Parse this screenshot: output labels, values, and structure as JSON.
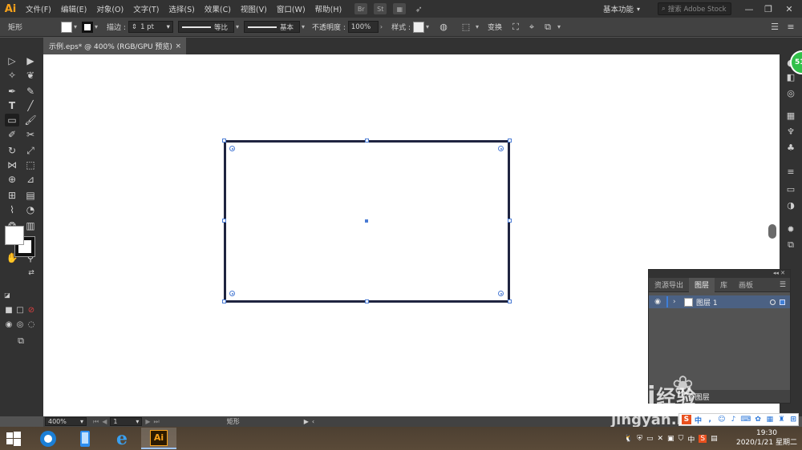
{
  "app": {
    "logo": "Ai",
    "menus": [
      "文件(F)",
      "编辑(E)",
      "对象(O)",
      "文字(T)",
      "选择(S)",
      "效果(C)",
      "视图(V)",
      "窗口(W)",
      "帮助(H)"
    ],
    "bridge_icon": "Br",
    "stock_icon": "St",
    "workspace": "基本功能",
    "search_placeholder": "搜索 Adobe Stock"
  },
  "control_bar": {
    "object_type": "矩形",
    "stroke_label": "描边 :",
    "stroke_weight": "1 pt",
    "profile_label": "等比",
    "brush_label": "基本",
    "opacity_label": "不透明度 :",
    "opacity_value": "100%",
    "style_label": "样式 :",
    "transform_label": "变换"
  },
  "document": {
    "tab_title": "示例.eps* @ 400% (RGB/GPU 预览)",
    "close": "×"
  },
  "status_bar": {
    "zoom": "400%",
    "artboard_index": "1",
    "selection_tool": "矩形"
  },
  "layers_panel": {
    "tabs": [
      "资源导出",
      "图层",
      "库",
      "画板"
    ],
    "active_tab": "图层",
    "layer_name": "图层 1",
    "footer_text": "1 个图层"
  },
  "watermark": {
    "brand": "Bai",
    "brand_cn": "经验",
    "url": "jingyan.baidu.com"
  },
  "dock": {
    "badge": "51"
  },
  "taskbar": {
    "ime_mode": "中",
    "time": "19:30",
    "date": "2020/1/21 星期二"
  },
  "colors": {
    "accent_ai": "#f7a21b",
    "selection": "#4a7bd4",
    "rect_stroke": "#1f2440",
    "layer_highlight": "#4b6183"
  }
}
